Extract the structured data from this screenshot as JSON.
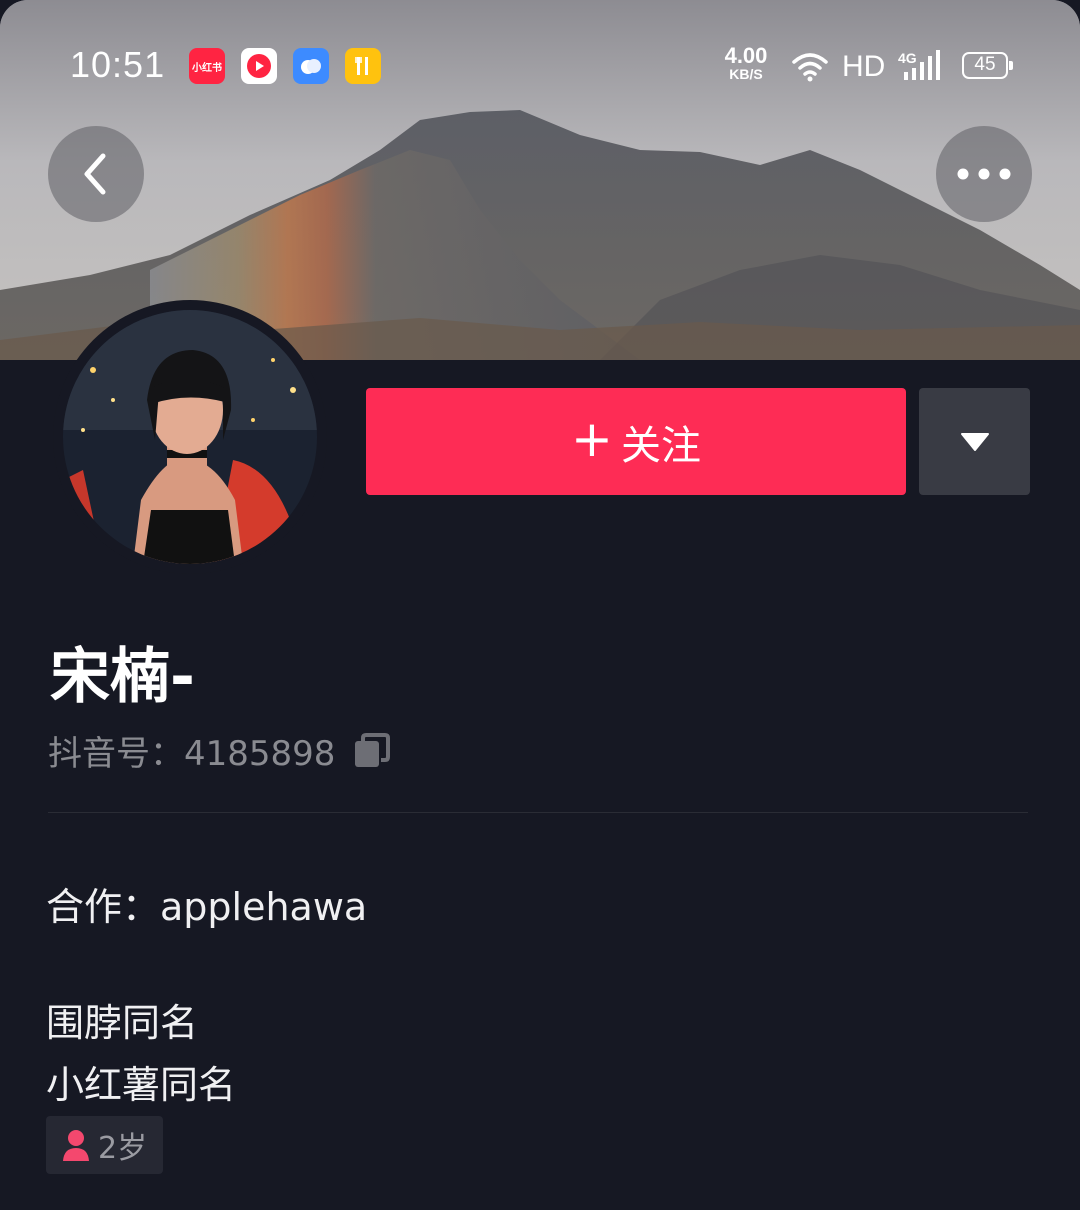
{
  "status_bar": {
    "time": "10:51",
    "net_speed_value": "4.00",
    "net_speed_unit": "KB/S",
    "network_hd": "HD",
    "network_type": "4G",
    "battery": "45",
    "app_icons": [
      {
        "name": "xiaohongshu-app-icon",
        "label": "小红书"
      },
      {
        "name": "video-app-icon"
      },
      {
        "name": "cloud-app-icon"
      },
      {
        "name": "food-app-icon"
      }
    ]
  },
  "header": {
    "back_icon": "chevron-left-icon",
    "more_icon": "more-dots-icon"
  },
  "profile": {
    "follow_label": "关注",
    "follow_plus": "+",
    "nickname": "宋楠-",
    "douyin_id_label": "抖音号：4185898",
    "bio": {
      "line1": "合作：applehawa",
      "line2": "围脖同名",
      "line3": "小红薯同名"
    },
    "tag_age": "2岁"
  },
  "colors": {
    "background": "#161823",
    "follow_button": "#fe2c55",
    "secondary_button": "#393b44",
    "muted_text": "#8a8b91"
  }
}
